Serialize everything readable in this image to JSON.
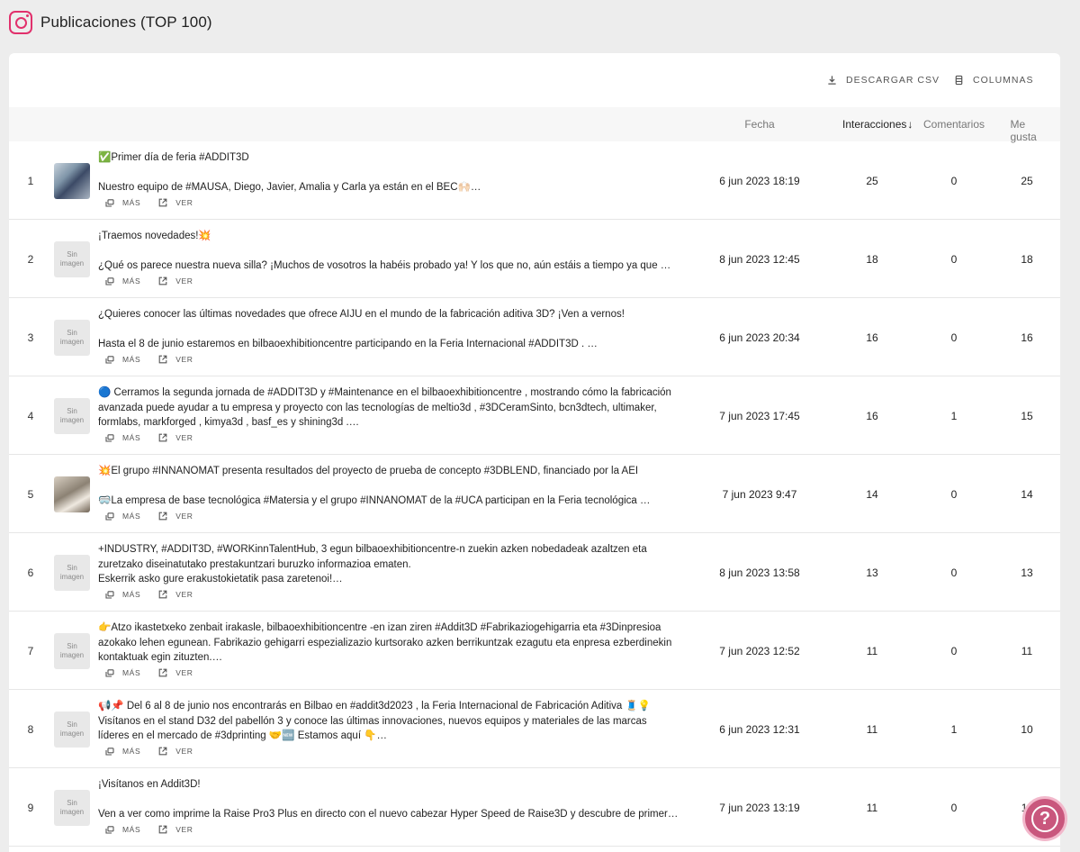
{
  "header": {
    "title": "Publicaciones (TOP 100)",
    "icon": "instagram-icon",
    "accent_color": "#e1306c"
  },
  "toolbar": {
    "download_label": "DESCARGAR CSV",
    "columns_label": "COLUMNAS"
  },
  "table": {
    "columns": {
      "fecha": "Fecha",
      "interacciones": "Interacciones",
      "comentarios": "Comentarios",
      "me_gusta": "Me gusta"
    },
    "sort_indicator": "↓",
    "no_image_line1": "Sin",
    "no_image_line2": "imagen",
    "more_label": "MÁS",
    "view_label": "VER",
    "rows": [
      {
        "num": "1",
        "has_image": true,
        "lines": [
          "✅Primer día de feria #ADDIT3D",
          "",
          "Nuestro equipo de #MAUSA, Diego, Javier, Amalia y Carla ya están en el BEC🙌🏻…"
        ],
        "date": "6 jun 2023 18:19",
        "interactions": "25",
        "comments": "0",
        "likes": "25"
      },
      {
        "num": "2",
        "has_image": false,
        "lines": [
          "¡Traemos novedades!💥",
          "",
          "¿Qué os parece nuestra nueva silla? ¡Muchos de vosotros la habéis probado ya! Y los que no, aún estáis a tiempo ya que …"
        ],
        "date": "8 jun 2023 12:45",
        "interactions": "18",
        "comments": "0",
        "likes": "18"
      },
      {
        "num": "3",
        "has_image": false,
        "lines": [
          "¿Quieres conocer las últimas novedades que ofrece AIJU en el mundo de la fabricación aditiva 3D? ¡Ven a vernos!",
          "",
          "Hasta el 8 de junio estaremos en bilbaoexhibitioncentre  participando en la Feria Internacional #ADDIT3D . …"
        ],
        "date": "6 jun 2023 20:34",
        "interactions": "16",
        "comments": "0",
        "likes": "16"
      },
      {
        "num": "4",
        "has_image": false,
        "lines": [
          "🔵 Cerramos la segunda jornada de #ADDIT3D y #Maintenance en el bilbaoexhibitioncentre , mostrando cómo la fabricación",
          "avanzada puede ayudar a tu empresa y proyecto con las tecnologías de meltio3d , #3DCeramSinto, bcn3dtech, ultimaker,",
          "formlabs, markforged , kimya3d , basf_es y shining3d .…"
        ],
        "date": "7 jun 2023 17:45",
        "interactions": "16",
        "comments": "1",
        "likes": "15"
      },
      {
        "num": "5",
        "has_image": true,
        "lines": [
          "💥El grupo #INNANOMAT presenta resultados del proyecto de prueba de concepto #3DBLEND, financiado por la AEI",
          "",
          "🥽La empresa de base tecnológica #Matersia y el grupo #INNANOMAT de la #UCA participan en la Feria tecnológica …"
        ],
        "date": "7 jun 2023 9:47",
        "interactions": "14",
        "comments": "0",
        "likes": "14"
      },
      {
        "num": "6",
        "has_image": false,
        "lines": [
          "+INDUSTRY, #ADDIT3D, #WORKinnTalentHub, 3 egun bilbaoexhibitioncentre-n zuekin azken nobedadeak azaltzen eta",
          "zuretzako diseinatutako prestakuntzari buruzko informazioa ematen.",
          "Eskerrik asko gure erakustokietatik pasa zaretenoi!…"
        ],
        "date": "8 jun 2023 13:58",
        "interactions": "13",
        "comments": "0",
        "likes": "13"
      },
      {
        "num": "7",
        "has_image": false,
        "lines": [
          "👉Atzo ikastetxeko zenbait irakasle, bilbaoexhibitioncentre -en izan ziren #Addit3D #Fabrikaziogehigarria eta #3Dinpresioa",
          "azokako lehen egunean. Fabrikazio gehigarri espezializazio kurtsorako azken berrikuntzak ezagutu eta enpresa ezberdinekin",
          "kontaktuak egin zituzten.…"
        ],
        "date": "7 jun 2023 12:52",
        "interactions": "11",
        "comments": "0",
        "likes": "11"
      },
      {
        "num": "8",
        "has_image": false,
        "lines": [
          "📢📌 Del 6 al 8 de junio nos encontrarás en Bilbao en #addit3d2023 , la Feria Internacional de Fabricación Aditiva 🧵💡",
          "Visítanos en el stand D32 del pabellón 3 y conoce las últimas innovaciones, nuevos equipos y materiales de las marcas",
          "líderes en el mercado de #3dprinting 🤝🆕 Estamos aquí 👇…"
        ],
        "date": "6 jun 2023 12:31",
        "interactions": "11",
        "comments": "1",
        "likes": "10"
      },
      {
        "num": "9",
        "has_image": false,
        "lines": [
          "¡Visítanos en Addit3D!",
          "",
          "Ven a ver como imprime la Raise Pro3 Plus en directo con el nuevo cabezar Hyper Speed de Raise3D y descubre de primer…"
        ],
        "date": "7 jun 2023 13:19",
        "interactions": "11",
        "comments": "0",
        "likes": "11"
      }
    ]
  },
  "help": {
    "label": "?",
    "color": "#c9577d"
  }
}
